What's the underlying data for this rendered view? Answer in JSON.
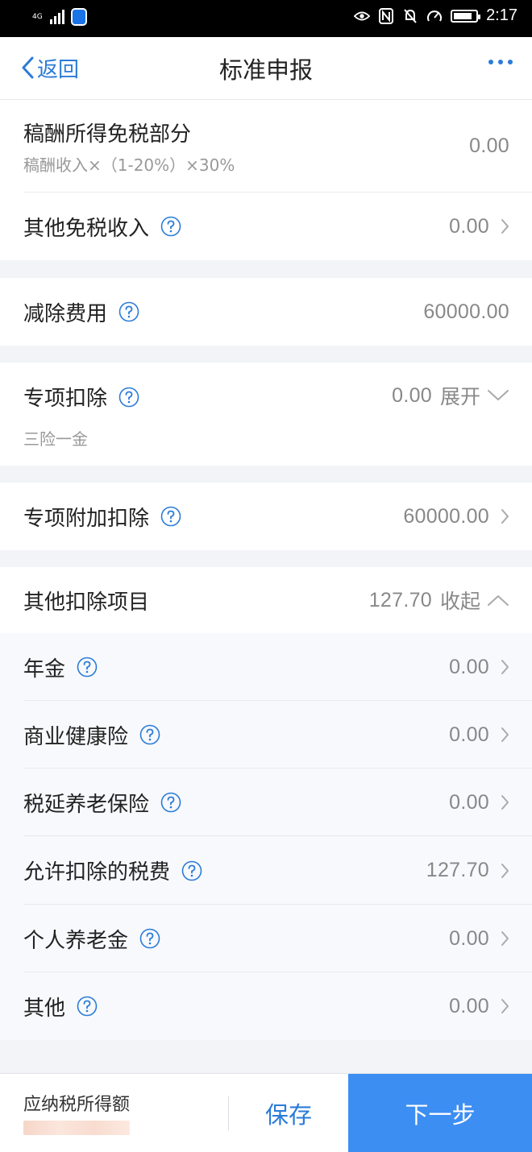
{
  "status_bar": {
    "network": "4G",
    "time": "2:17"
  },
  "nav": {
    "back_label": "返回",
    "title": "标准申报"
  },
  "remuneration_exempt": {
    "label": "稿酬所得免税部分",
    "formula": "稿酬收入×（1-20%）×30%",
    "value": "0.00"
  },
  "other_exempt_income": {
    "label": "其他免税收入",
    "value": "0.00"
  },
  "deduction_expense": {
    "label": "减除费用",
    "value": "60000.00"
  },
  "special_deduction": {
    "label": "专项扣除",
    "value": "0.00",
    "toggle": "展开",
    "subtitle": "三险一金"
  },
  "special_additional_deduction": {
    "label": "专项附加扣除",
    "value": "60000.00"
  },
  "other_deductions": {
    "label": "其他扣除项目",
    "value": "127.70",
    "toggle": "收起",
    "items": [
      {
        "label": "年金",
        "value": "0.00"
      },
      {
        "label": "商业健康险",
        "value": "0.00"
      },
      {
        "label": "税延养老保险",
        "value": "0.00"
      },
      {
        "label": "允许扣除的税费",
        "value": "127.70"
      },
      {
        "label": "个人养老金",
        "value": "0.00"
      },
      {
        "label": "其他",
        "value": "0.00"
      }
    ]
  },
  "bottom_bar": {
    "taxable_income_label": "应纳税所得额",
    "save_label": "保存",
    "next_label": "下一步"
  },
  "colors": {
    "accent": "#2b7bd8",
    "primary_button": "#3d8ef2",
    "page_bg": "#f2f4f8"
  }
}
